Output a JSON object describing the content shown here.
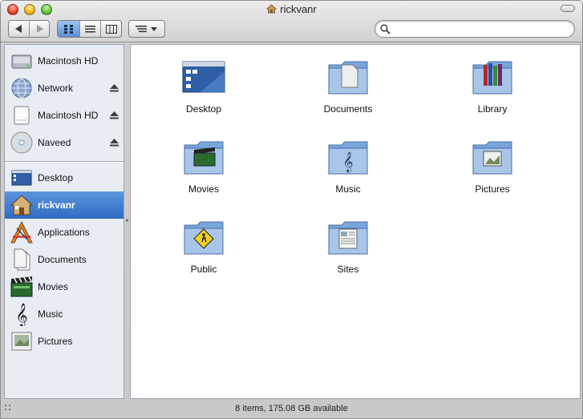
{
  "window": {
    "title": "rickvanr"
  },
  "toolbar": {
    "back_icon": "arrow-left-icon",
    "forward_icon": "arrow-right-icon",
    "view_modes": [
      "icon-view",
      "list-view",
      "column-view"
    ],
    "active_view": "icon-view",
    "arrange_icon": "arrange-icon",
    "search": {
      "value": "",
      "placeholder": ""
    }
  },
  "sidebar": {
    "devices": [
      {
        "label": "Macintosh HD",
        "icon": "hard-drive-icon",
        "eject": false
      },
      {
        "label": "Network",
        "icon": "network-globe-icon",
        "eject": true
      },
      {
        "label": "Macintosh HD",
        "icon": "external-drive-icon",
        "eject": true
      },
      {
        "label": "Naveed",
        "icon": "cd-disc-icon",
        "eject": true
      }
    ],
    "places": [
      {
        "label": "Desktop",
        "icon": "desktop-icon",
        "selected": false
      },
      {
        "label": "rickvanr",
        "icon": "home-icon",
        "selected": true
      },
      {
        "label": "Applications",
        "icon": "applications-icon",
        "selected": false
      },
      {
        "label": "Documents",
        "icon": "documents-icon",
        "selected": false
      },
      {
        "label": "Movies",
        "icon": "movies-icon",
        "selected": false
      },
      {
        "label": "Music",
        "icon": "music-icon",
        "selected": false
      },
      {
        "label": "Pictures",
        "icon": "pictures-icon",
        "selected": false
      }
    ]
  },
  "content": {
    "items": [
      {
        "label": "Desktop",
        "icon": "desktop-folder-icon"
      },
      {
        "label": "Documents",
        "icon": "documents-folder-icon"
      },
      {
        "label": "Library",
        "icon": "library-folder-icon"
      },
      {
        "label": "Movies",
        "icon": "movies-folder-icon"
      },
      {
        "label": "Music",
        "icon": "music-folder-icon"
      },
      {
        "label": "Pictures",
        "icon": "pictures-folder-icon"
      },
      {
        "label": "Public",
        "icon": "public-folder-icon"
      },
      {
        "label": "Sites",
        "icon": "sites-folder-icon"
      }
    ]
  },
  "status": {
    "text": "8 items, 175.08 GB available"
  },
  "colors": {
    "selection": "#3a76cc",
    "sidebar_bg": "#e8edf4",
    "folder_blue": "#7aa6dc"
  }
}
